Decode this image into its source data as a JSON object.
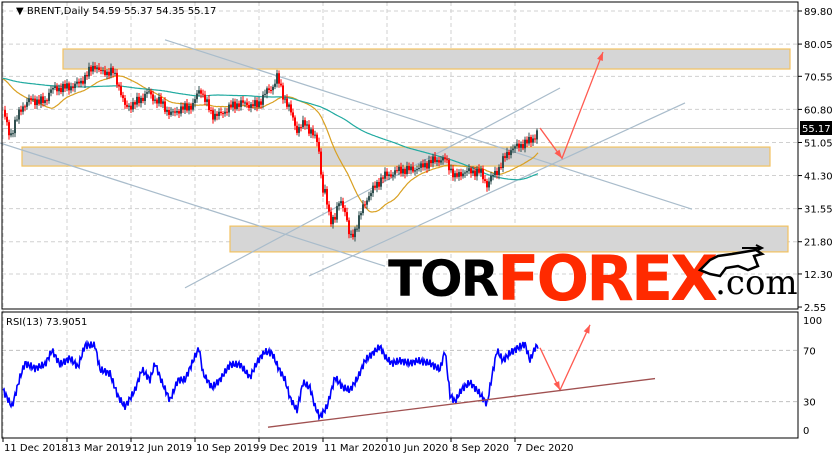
{
  "chart_data": {
    "type": "candlestick",
    "symbol": "BRENT",
    "timeframe": "Daily",
    "header": {
      "symbol_tf": "BRENT,Daily",
      "open": "54.59",
      "high": "55.37",
      "low": "54.35",
      "close": "55.17"
    },
    "current_price": 55.17,
    "current_price_label": "55.17",
    "price_axis": {
      "ticks": [
        "89.80",
        "80.05",
        "70.55",
        "60.80",
        "51.05",
        "41.30",
        "31.55",
        "21.80",
        "12.30",
        "2.55"
      ],
      "range": [
        2.55,
        89.8
      ]
    },
    "x_axis": {
      "ticks": [
        "11 Dec 2018",
        "13 Mar 2019",
        "12 Jun 2019",
        "10 Sep 2019",
        "9 Dec 2019",
        "11 Mar 2020",
        "10 Jun 2020",
        "8 Sep 2020",
        "7 Dec 2020"
      ],
      "bars_per_tick": 64
    },
    "close_path": [
      [
        0,
        60.6
      ],
      [
        7,
        52.7
      ],
      [
        12,
        56.8
      ],
      [
        19,
        61.5
      ],
      [
        27,
        63.6
      ],
      [
        42,
        63.0
      ],
      [
        47,
        66.5
      ],
      [
        57,
        67.1
      ],
      [
        67,
        67.4
      ],
      [
        77,
        68.6
      ],
      [
        85,
        71.5
      ],
      [
        92,
        73.9
      ],
      [
        97,
        71.8
      ],
      [
        110,
        71.8
      ],
      [
        115,
        68.6
      ],
      [
        122,
        61.5
      ],
      [
        129,
        62.1
      ],
      [
        137,
        63.6
      ],
      [
        145,
        65.9
      ],
      [
        152,
        63.6
      ],
      [
        159,
        62.7
      ],
      [
        167,
        59.2
      ],
      [
        175,
        60.6
      ],
      [
        182,
        61.2
      ],
      [
        190,
        62.1
      ],
      [
        197,
        67.1
      ],
      [
        202,
        63.6
      ],
      [
        209,
        59.2
      ],
      [
        217,
        59.2
      ],
      [
        227,
        61.5
      ],
      [
        237,
        62.7
      ],
      [
        247,
        62.1
      ],
      [
        255,
        62.1
      ],
      [
        262,
        65.6
      ],
      [
        269,
        67.1
      ],
      [
        274,
        70.4
      ],
      [
        280,
        65.0
      ],
      [
        287,
        60.6
      ],
      [
        294,
        54.7
      ],
      [
        302,
        56.8
      ],
      [
        309,
        53.8
      ],
      [
        315,
        50.9
      ],
      [
        317,
        46.8
      ],
      [
        319,
        37.0
      ],
      [
        322,
        36.2
      ],
      [
        327,
        28.2
      ],
      [
        332,
        29.1
      ],
      [
        337,
        34.1
      ],
      [
        342,
        31.2
      ],
      [
        347,
        22.3
      ],
      [
        352,
        25.3
      ],
      [
        359,
        31.2
      ],
      [
        365,
        35.1
      ],
      [
        372,
        38.0
      ],
      [
        380,
        41.0
      ],
      [
        387,
        41.6
      ],
      [
        397,
        43.0
      ],
      [
        407,
        43.0
      ],
      [
        417,
        43.6
      ],
      [
        427,
        45.4
      ],
      [
        437,
        46.0
      ],
      [
        442,
        46.0
      ],
      [
        447,
        43.6
      ],
      [
        452,
        40.7
      ],
      [
        459,
        42.2
      ],
      [
        467,
        42.5
      ],
      [
        477,
        42.5
      ],
      [
        484,
        38.6
      ],
      [
        489,
        41.0
      ],
      [
        497,
        43.8
      ],
      [
        502,
        46.8
      ],
      [
        507,
        48.8
      ],
      [
        517,
        50.3
      ],
      [
        525,
        51.2
      ],
      [
        532,
        52.7
      ],
      [
        535,
        55.17
      ]
    ],
    "moving_averages": [
      {
        "name": "MA fast",
        "period": 50,
        "color": "#d9a021"
      },
      {
        "name": "MA slow",
        "period": 200,
        "color": "#20aaa0"
      }
    ],
    "zones": [
      {
        "name": "resistance-zone",
        "price": [
          72.7,
          78.6
        ],
        "bars": [
          60,
          787
        ]
      },
      {
        "name": "pivot-zone",
        "price": [
          44.1,
          49.7
        ],
        "bars": [
          19,
          767
        ]
      },
      {
        "name": "support-zone",
        "price": [
          18.8,
          26.4
        ],
        "bars": [
          227,
          785
        ]
      }
    ],
    "trendlines": [
      [
        [
          -3,
          50.9
        ],
        [
          382,
          14.6
        ]
      ],
      [
        [
          162,
          81.3
        ],
        [
          689,
          31.4
        ]
      ],
      [
        [
          182,
          8.2
        ],
        [
          557,
          67.1
        ]
      ],
      [
        [
          306,
          11.7
        ],
        [
          682,
          62.7
        ]
      ]
    ],
    "forecast_arrow": [
      [
        537,
        55.3
      ],
      [
        559,
        46.4
      ],
      [
        600,
        77.7
      ]
    ],
    "rsi": {
      "label": "RSI(13) 73.9051",
      "ticks": [
        "100",
        "70",
        "30",
        "0"
      ],
      "levels": [
        70,
        30
      ],
      "values": [
        [
          0,
          39
        ],
        [
          9,
          26
        ],
        [
          17,
          49
        ],
        [
          22,
          60
        ],
        [
          32,
          56
        ],
        [
          42,
          59
        ],
        [
          49,
          70
        ],
        [
          57,
          59
        ],
        [
          67,
          64
        ],
        [
          75,
          57
        ],
        [
          82,
          74
        ],
        [
          92,
          74
        ],
        [
          97,
          55
        ],
        [
          107,
          52
        ],
        [
          115,
          34
        ],
        [
          122,
          26
        ],
        [
          132,
          39
        ],
        [
          139,
          55
        ],
        [
          147,
          47
        ],
        [
          152,
          60
        ],
        [
          159,
          45
        ],
        [
          167,
          31
        ],
        [
          175,
          47
        ],
        [
          182,
          47
        ],
        [
          189,
          60
        ],
        [
          196,
          72
        ],
        [
          200,
          52
        ],
        [
          209,
          41
        ],
        [
          217,
          47
        ],
        [
          227,
          59
        ],
        [
          237,
          59
        ],
        [
          247,
          49
        ],
        [
          255,
          62
        ],
        [
          262,
          69
        ],
        [
          269,
          68
        ],
        [
          275,
          57
        ],
        [
          282,
          47
        ],
        [
          287,
          33
        ],
        [
          294,
          23
        ],
        [
          300,
          45
        ],
        [
          307,
          41
        ],
        [
          312,
          26
        ],
        [
          317,
          18
        ],
        [
          324,
          26
        ],
        [
          332,
          49
        ],
        [
          340,
          41
        ],
        [
          347,
          39
        ],
        [
          355,
          49
        ],
        [
          362,
          62
        ],
        [
          370,
          68
        ],
        [
          377,
          73
        ],
        [
          383,
          64
        ],
        [
          389,
          60
        ],
        [
          397,
          62
        ],
        [
          407,
          60
        ],
        [
          415,
          62
        ],
        [
          427,
          60
        ],
        [
          437,
          55
        ],
        [
          442,
          70
        ],
        [
          447,
          35
        ],
        [
          452,
          30
        ],
        [
          459,
          40
        ],
        [
          467,
          45
        ],
        [
          475,
          38
        ],
        [
          484,
          28
        ],
        [
          489,
          50
        ],
        [
          494,
          70
        ],
        [
          500,
          62
        ],
        [
          507,
          68
        ],
        [
          515,
          72
        ],
        [
          522,
          75
        ],
        [
          527,
          62
        ],
        [
          532,
          72
        ],
        [
          535,
          73.9
        ]
      ],
      "trendline": [
        [
          265,
          10
        ],
        [
          652,
          48
        ]
      ],
      "forecast_arrow": [
        [
          537,
          72
        ],
        [
          557,
          39
        ],
        [
          587,
          90
        ]
      ]
    },
    "colors": {
      "bull": "#2f4f4f",
      "bear": "#ff0000",
      "rsi": "#0000ff",
      "trendline": "#a9bccb",
      "arrow": "#ff5a50",
      "rsi_trend": "#a05050",
      "zone_fill": "#d6d6d6",
      "zone_border": "#f2c260"
    }
  },
  "logo": {
    "tor": "TOR",
    "forex": "FOREX",
    "com": ".com"
  }
}
